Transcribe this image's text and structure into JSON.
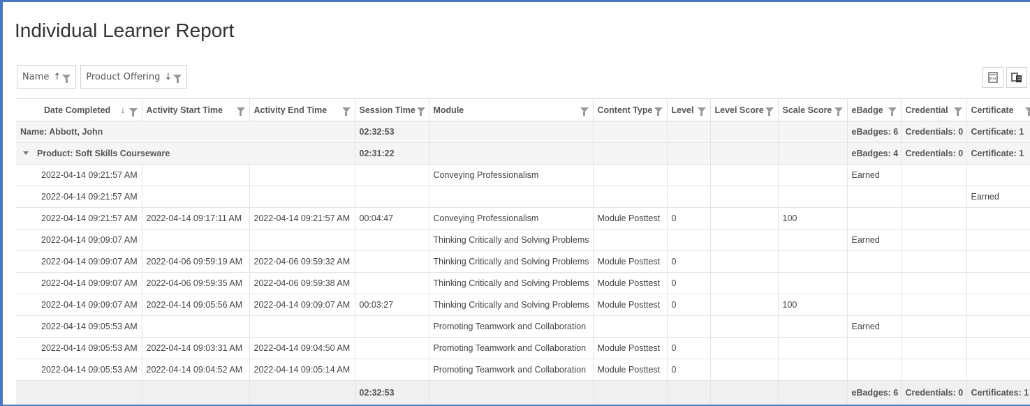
{
  "page": {
    "title": "Individual Learner Report"
  },
  "group_panel": [
    {
      "label": "Name",
      "sort": "↑"
    },
    {
      "label": "Product Offering",
      "sort": "↓"
    }
  ],
  "export": {
    "xlsx_label": "xlsx"
  },
  "columns": [
    "Date Completed",
    "Activity Start Time",
    "Activity End Time",
    "Session Time",
    "Module",
    "Content Type",
    "Level",
    "Level Score",
    "Scale Score",
    "eBadge",
    "Credential",
    "Certificate"
  ],
  "date_sort": "↓",
  "groups": {
    "name_row": {
      "label": "Name: Abbott, John",
      "session": "02:32:53",
      "ebadges": "eBadges: 6",
      "credentials": "Credentials: 0",
      "certificate": "Certificate: 1"
    },
    "product_row": {
      "label": "Product: Soft Skills Courseware",
      "session": "02:31:22",
      "ebadges": "eBadges: 4",
      "credentials": "Credentials: 0",
      "certificate": "Certificate: 1"
    }
  },
  "rows": [
    [
      "2022-04-14 09:21:57 AM",
      "",
      "",
      "",
      "Conveying Professionalism",
      "",
      "",
      "",
      "",
      "Earned",
      "",
      ""
    ],
    [
      "2022-04-14 09:21:57 AM",
      "",
      "",
      "",
      "",
      "",
      "",
      "",
      "",
      "",
      "",
      "Earned"
    ],
    [
      "2022-04-14 09:21:57 AM",
      "2022-04-14 09:17:11 AM",
      "2022-04-14 09:21:57 AM",
      "00:04:47",
      "Conveying Professionalism",
      "Module Posttest",
      "0",
      "",
      "100",
      "",
      "",
      ""
    ],
    [
      "2022-04-14 09:09:07 AM",
      "",
      "",
      "",
      "Thinking Critically and Solving Problems",
      "",
      "",
      "",
      "",
      "Earned",
      "",
      ""
    ],
    [
      "2022-04-14 09:09:07 AM",
      "2022-04-06 09:59:19 AM",
      "2022-04-06 09:59:32 AM",
      "",
      "Thinking Critically and Solving Problems",
      "Module Posttest",
      "0",
      "",
      "",
      "",
      "",
      ""
    ],
    [
      "2022-04-14 09:09:07 AM",
      "2022-04-06 09:59:35 AM",
      "2022-04-06 09:59:38 AM",
      "",
      "Thinking Critically and Solving Problems",
      "Module Posttest",
      "0",
      "",
      "",
      "",
      "",
      ""
    ],
    [
      "2022-04-14 09:09:07 AM",
      "2022-04-14 09:05:56 AM",
      "2022-04-14 09:09:07 AM",
      "00:03:27",
      "Thinking Critically and Solving Problems",
      "Module Posttest",
      "0",
      "",
      "100",
      "",
      "",
      ""
    ],
    [
      "2022-04-14 09:05:53 AM",
      "",
      "",
      "",
      "Promoting Teamwork and Collaboration",
      "",
      "",
      "",
      "",
      "Earned",
      "",
      ""
    ],
    [
      "2022-04-14 09:05:53 AM",
      "2022-04-14 09:03:31 AM",
      "2022-04-14 09:04:50 AM",
      "",
      "Promoting Teamwork and Collaboration",
      "Module Posttest",
      "0",
      "",
      "",
      "",
      "",
      ""
    ],
    [
      "2022-04-14 09:05:53 AM",
      "2022-04-14 09:04:52 AM",
      "2022-04-14 09:05:14 AM",
      "",
      "Promoting Teamwork and Collaboration",
      "Module Posttest",
      "0",
      "",
      "",
      "",
      "",
      ""
    ]
  ],
  "footer": {
    "session": "02:32:53",
    "ebadges": "eBadges: 6",
    "credentials": "Credentials: 0",
    "certificates": "Certificates: 1"
  }
}
